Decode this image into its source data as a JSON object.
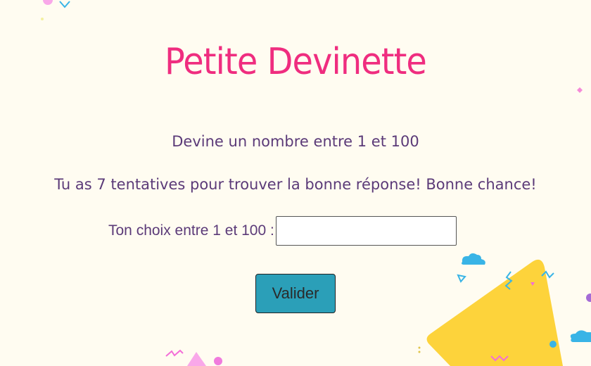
{
  "page": {
    "title": "Petite Devinette",
    "intro": "Devine un nombre entre 1 et 100",
    "attempts_message": "Tu as 7 tentatives pour trouver la bonne réponse! Bonne chance!"
  },
  "form": {
    "label": "Ton choix entre 1 et 100 :",
    "input_value": "",
    "submit_label": "Valider"
  },
  "colors": {
    "background": "#fffcf1",
    "title": "#ef2d7f",
    "text": "#5b3a78",
    "button": "#2b9fb8",
    "decor_yellow": "#fdd33b",
    "decor_blue": "#39b4e6",
    "decor_pink": "#f36dd8"
  }
}
